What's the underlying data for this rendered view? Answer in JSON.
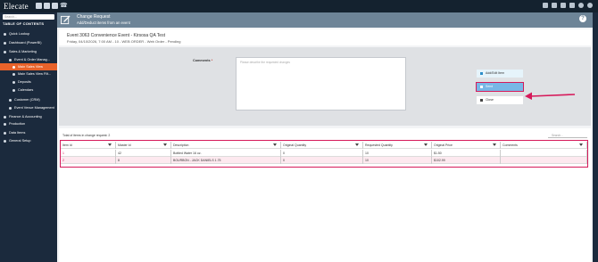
{
  "app": {
    "logo": "Elecate",
    "sidebar": {
      "search_placeholder": "Search...",
      "toc_label": "TABLE OF CONTENTS",
      "items": [
        {
          "label": "Quick Lookup",
          "indent": 0
        },
        {
          "label": "Dashboard (PowerBI)",
          "indent": 0
        },
        {
          "label": "Sales & Marketing",
          "indent": 0
        },
        {
          "label": "Event & Order Manag...",
          "indent": 1
        },
        {
          "label": "Main Sales View",
          "indent": 2,
          "active": true
        },
        {
          "label": "Main Sales View Filt...",
          "indent": 2
        },
        {
          "label": "Deposits",
          "indent": 2
        },
        {
          "label": "Calendars",
          "indent": 2
        },
        {
          "label": "Customer (CRM)",
          "indent": 1
        },
        {
          "label": "Event Venue Management",
          "indent": 1
        },
        {
          "label": "Finance & Accounting",
          "indent": 0
        },
        {
          "label": "Production",
          "indent": 0
        },
        {
          "label": "Data Items",
          "indent": 0
        },
        {
          "label": "General Setup",
          "indent": 0
        }
      ]
    }
  },
  "header": {
    "title": "Change Request",
    "subtitle": "Add/Deduct items from an event",
    "help_label": "?"
  },
  "event": {
    "title": "Event 3063 Convenience Event - Kirsosa QA Test",
    "date_line": "Friday, 04/10/2026, 7:00 AM - 10 - WEB ORDER - Web Order - Pending"
  },
  "comments": {
    "label": "Comments",
    "required_mark": "*",
    "placeholder": "Please describe the requested changes"
  },
  "actions": {
    "add_edit": "Add/Edit Item",
    "send": "Send",
    "close": "Close"
  },
  "table": {
    "count_text": "Total of items in change request: 2",
    "search_placeholder": "Search...",
    "columns": [
      "Item Id",
      "Master Id",
      "Description",
      "Original Quantity",
      "Requested Quantity",
      "Original Price",
      "Comments"
    ],
    "rows": [
      [
        "1",
        "42",
        "Bottled Water 16 oz.",
        "0",
        "10",
        "$1.50",
        ""
      ],
      [
        "2",
        "8",
        "BOURBON - JACK DANIELS 1.75",
        "0",
        "10",
        "$102.99",
        ""
      ]
    ]
  },
  "colors": {
    "sidebar_bg": "#1b2a3d",
    "active_item": "#e8622a",
    "header_bg": "#6d8497",
    "highlight": "#d6195a",
    "send_button": "#78b7e6"
  }
}
